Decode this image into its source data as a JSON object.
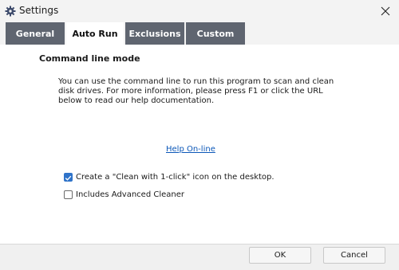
{
  "window": {
    "title": "Settings"
  },
  "tabs": [
    {
      "label": "General",
      "active": false
    },
    {
      "label": "Auto Run",
      "active": true
    },
    {
      "label": "Exclusions",
      "active": false
    },
    {
      "label": "Custom",
      "active": false
    }
  ],
  "auto_run": {
    "section_title": "Command line mode",
    "description": "You can use the command line to run this program to scan and clean disk drives. For more information, please press F1 or click the URL below to read our help documentation.",
    "help_link": "Help On-line",
    "options": [
      {
        "label": "Create a \"Clean with 1-click\" icon on the desktop.",
        "checked": true
      },
      {
        "label": "Includes Advanced Cleaner",
        "checked": false
      }
    ]
  },
  "footer": {
    "ok_label": "OK",
    "cancel_label": "Cancel"
  },
  "colors": {
    "tab_inactive": "#5f6570",
    "checkbox_checked": "#2f73c9",
    "link": "#0b57b8"
  },
  "icons": {
    "title": "gear-icon",
    "close": "close-icon",
    "check": "checkmark-icon"
  }
}
